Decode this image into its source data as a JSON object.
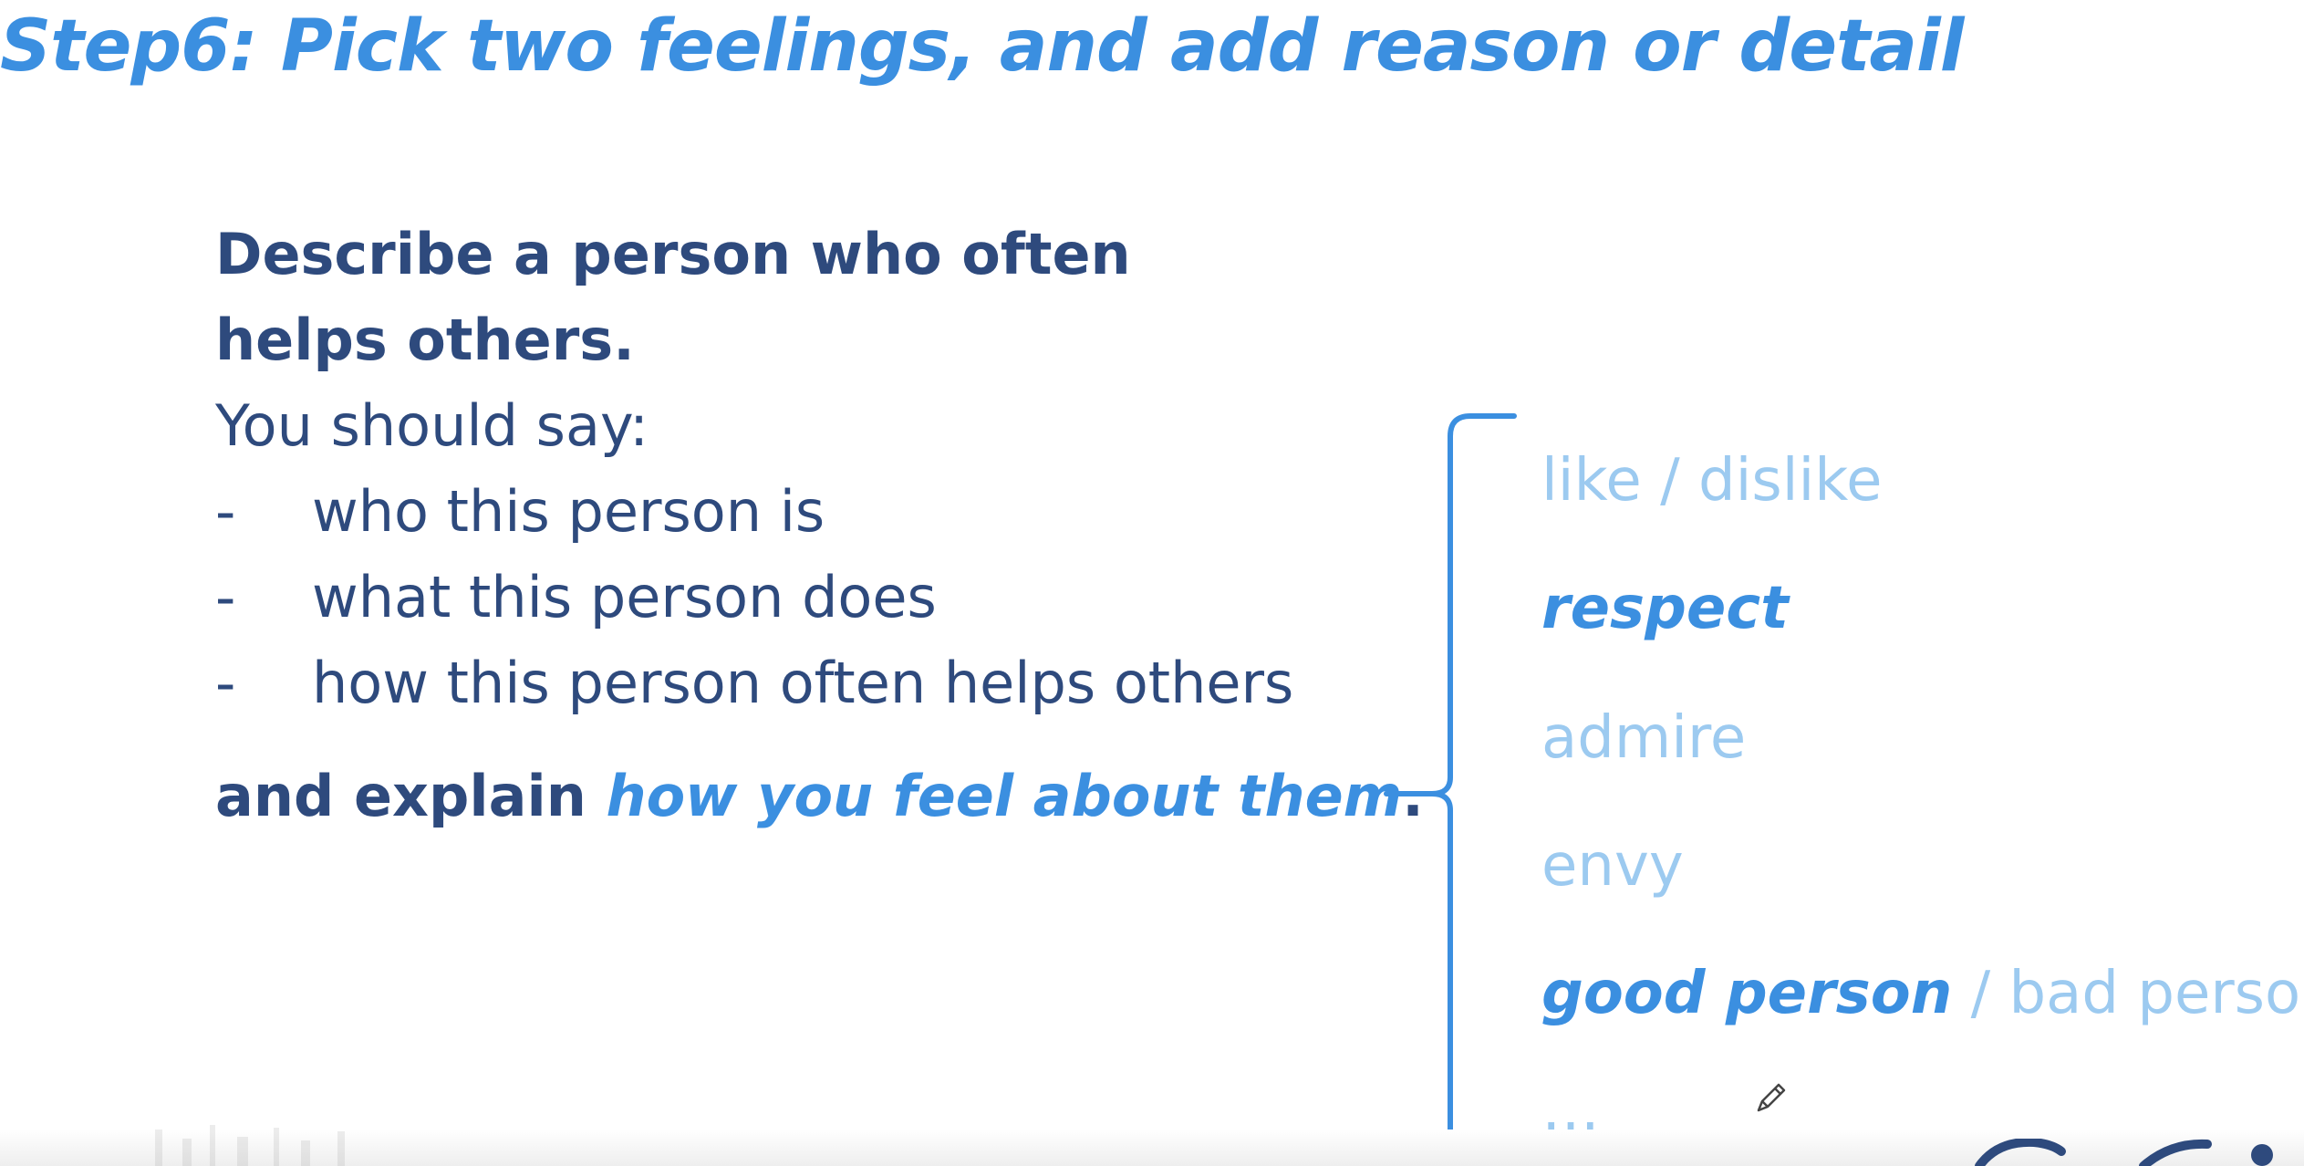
{
  "title": "Step6:  Pick two feelings, and add reason or detail",
  "prompt": {
    "heading_line1": "Describe a person who often",
    "heading_line2": "helps others.",
    "intro": "You should say:",
    "bullets": [
      {
        "dash": "-",
        "text": "who this person is"
      },
      {
        "dash": "-",
        "text": "what this person does"
      },
      {
        "dash": "-",
        "text": "how this person often helps others"
      }
    ],
    "explain_prefix": "and explain ",
    "explain_emphasis": "how you feel about them",
    "explain_suffix": "."
  },
  "feelings": [
    {
      "text": "like / dislike",
      "highlight": false
    },
    {
      "text": "respect",
      "highlight": true
    },
    {
      "text": "admire",
      "highlight": false
    },
    {
      "text": "envy",
      "highlight": false
    },
    {
      "highlight_part": "good person",
      "separator": " / ",
      "plain_part": "bad person"
    },
    {
      "text": "…",
      "highlight": false
    }
  ],
  "colors": {
    "title_blue": "#3b8fe0",
    "prompt_navy": "#2e4a7d",
    "feeling_light": "#9ccaf0",
    "brace_blue": "#3b8fe0"
  },
  "icons": {
    "pencil": "pencil-icon"
  }
}
